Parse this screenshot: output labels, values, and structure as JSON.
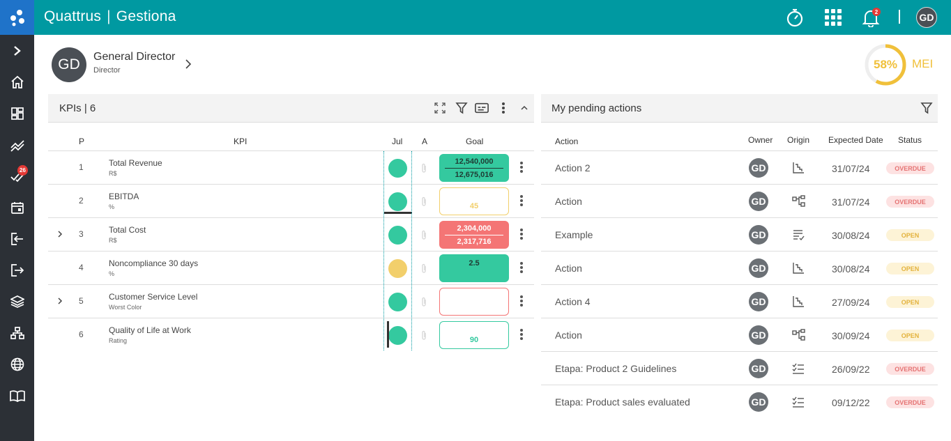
{
  "app": {
    "brand": "Quattrus",
    "module": "Gestiona",
    "brand_separator": "|"
  },
  "colors": {
    "topbar": "#0099a1",
    "sidebar": "#2c3036",
    "logo_bg": "#1f73c9",
    "green": "#34c99f",
    "yellow": "#f2cf6b",
    "red": "#f47575",
    "overdue_bg": "#fde2e2",
    "overdue_text": "#e57373",
    "open_bg": "#fdf3d6",
    "open_text": "#e3b23c"
  },
  "sidebar": {
    "items": [
      {
        "icon": "chevron-right-icon"
      },
      {
        "icon": "home-icon"
      },
      {
        "icon": "dashboard-icon"
      },
      {
        "icon": "trend-icon"
      },
      {
        "icon": "checks-icon",
        "badge": "26"
      },
      {
        "icon": "calendar-icon"
      },
      {
        "icon": "login-icon"
      },
      {
        "icon": "logout-icon"
      },
      {
        "icon": "layers-icon"
      },
      {
        "icon": "org-chart-icon"
      },
      {
        "icon": "globe-icon"
      },
      {
        "icon": "book-icon"
      }
    ]
  },
  "topbar": {
    "bell_badge": "2",
    "avatar": "GD"
  },
  "profile": {
    "initials": "GD",
    "name": "General Director",
    "role": "Director"
  },
  "mei": {
    "percent": "58%",
    "label": "MEI",
    "value": 0.58
  },
  "kpi_panel": {
    "title": "KPIs | 6",
    "columns": {
      "p": "P",
      "kpi": "KPI",
      "month": "Jul",
      "a": "A",
      "goal": "Goal"
    },
    "rows": [
      {
        "p": "1",
        "name": "Total Revenue",
        "unit": "R$",
        "expandable": false,
        "status": "green",
        "goal_top": "12,540,000",
        "goal_bottom": "12,675,016",
        "goal_style": "filled-green"
      },
      {
        "p": "2",
        "name": "EBITDA",
        "unit": "%",
        "expandable": false,
        "status": "green",
        "goal_top": "",
        "goal_bottom": "45",
        "goal_style": "outline-yellow"
      },
      {
        "p": "3",
        "name": "Total Cost",
        "unit": "R$",
        "expandable": true,
        "status": "green",
        "goal_top": "2,304,000",
        "goal_bottom": "2,317,716",
        "goal_style": "filled-red"
      },
      {
        "p": "4",
        "name": "Noncompliance 30 days",
        "unit": "%",
        "expandable": false,
        "status": "yellow",
        "goal_top": "2.5",
        "goal_bottom": "",
        "goal_style": "filled-green"
      },
      {
        "p": "5",
        "name": "Customer Service Level",
        "unit": "Worst Color",
        "expandable": true,
        "status": "green",
        "goal_top": "",
        "goal_bottom": "",
        "goal_style": "outline-red"
      },
      {
        "p": "6",
        "name": "Quality of Life at Work",
        "unit": "Rating",
        "expandable": false,
        "status": "green",
        "goal_top": "",
        "goal_bottom": "90",
        "goal_style": "outline-green"
      }
    ]
  },
  "actions_panel": {
    "title": "My pending actions",
    "columns": {
      "action": "Action",
      "owner": "Owner",
      "origin": "Origin",
      "date": "Expected Date",
      "status": "Status"
    },
    "rows": [
      {
        "action": "Action 2",
        "owner": "GD",
        "origin": "chart-icon",
        "date": "31/07/24",
        "status": "OVERDUE"
      },
      {
        "action": "Action",
        "owner": "GD",
        "origin": "hierarchy-icon",
        "date": "31/07/24",
        "status": "OVERDUE"
      },
      {
        "action": "Example",
        "owner": "GD",
        "origin": "checklist-icon",
        "date": "30/08/24",
        "status": "OPEN"
      },
      {
        "action": "Action",
        "owner": "GD",
        "origin": "chart-icon",
        "date": "30/08/24",
        "status": "OPEN"
      },
      {
        "action": "Action 4",
        "owner": "GD",
        "origin": "chart-icon",
        "date": "27/09/24",
        "status": "OPEN"
      },
      {
        "action": "Action",
        "owner": "GD",
        "origin": "hierarchy-icon",
        "date": "30/09/24",
        "status": "OPEN"
      },
      {
        "action": "Etapa: Product 2 Guidelines",
        "owner": "GD",
        "origin": "task-list-icon",
        "date": "26/09/22",
        "status": "OVERDUE"
      },
      {
        "action": "Etapa: Product sales evaluated",
        "owner": "GD",
        "origin": "task-list-icon",
        "date": "09/12/22",
        "status": "OVERDUE"
      }
    ]
  }
}
